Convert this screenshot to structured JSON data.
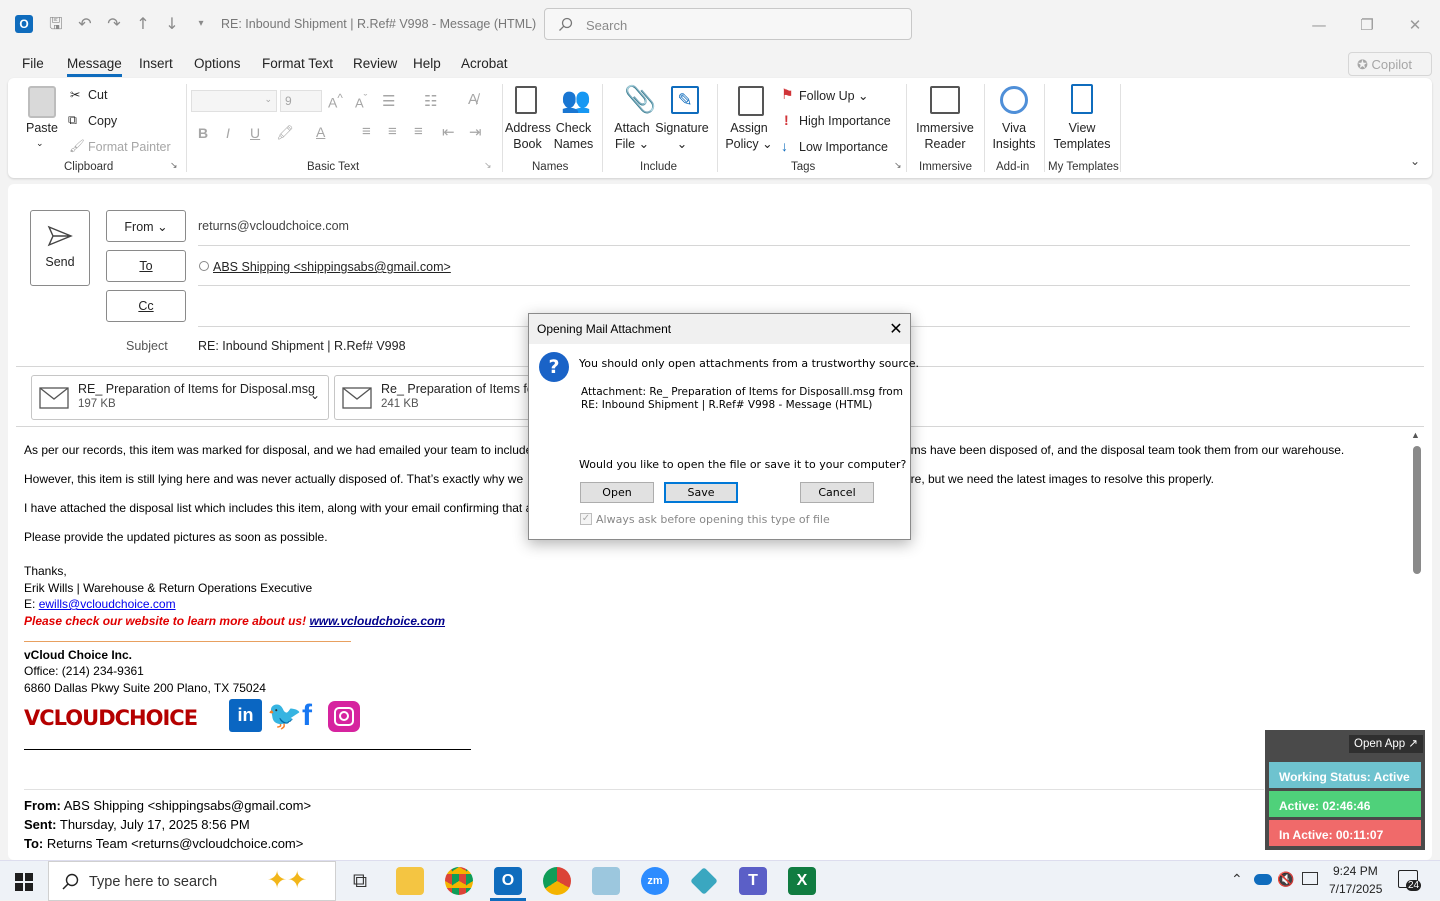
{
  "titlebar": {
    "title": "RE: Inbound Shipment | R.Ref# V998  -  Message (HTML)",
    "search_placeholder": "Search",
    "copilot": "Copilot"
  },
  "menu": [
    "File",
    "Message",
    "Insert",
    "Options",
    "Format Text",
    "Review",
    "Help",
    "Acrobat"
  ],
  "ribbon": {
    "clipboard": {
      "paste": "Paste",
      "cut": "Cut",
      "copy": "Copy",
      "format_painter": "Format Painter",
      "label": "Clipboard"
    },
    "basic_text": {
      "font_size": "9",
      "label": "Basic Text"
    },
    "names": {
      "address_book": [
        "Address",
        "Book"
      ],
      "check_names": [
        "Check",
        "Names"
      ],
      "label": "Names"
    },
    "include": {
      "attach_file": [
        "Attach",
        "File"
      ],
      "signature": "Signature",
      "label": "Include"
    },
    "tags": {
      "assign_policy": [
        "Assign",
        "Policy"
      ],
      "follow_up": "Follow Up",
      "high_importance": "High Importance",
      "low_importance": "Low Importance",
      "label": "Tags"
    },
    "immersive": {
      "reader": [
        "Immersive",
        "Reader"
      ],
      "label": "Immersive"
    },
    "addin": {
      "viva": [
        "Viva",
        "Insights"
      ],
      "label": "Add-in"
    },
    "templates": {
      "view": [
        "View",
        "Templates"
      ],
      "label": "My Templates"
    }
  },
  "compose": {
    "send": "Send",
    "from_label": "From",
    "from_value": "returns@vcloudchoice.com",
    "to_label": "To",
    "to_value": "ABS Shipping <shippingsabs@gmail.com>",
    "cc_label": "Cc",
    "subject_label": "Subject",
    "subject_value": "RE: Inbound Shipment | R.Ref# V998",
    "attachments": [
      {
        "name": "RE_ Preparation of Items for Disposal.msg",
        "size": "197 KB"
      },
      {
        "name": "Re_ Preparation of Items for",
        "size": "241 KB"
      }
    ]
  },
  "body": {
    "p1a": "As per our records, this item was marked for disposal, and we had emailed your team to include",
    "p1b": "ems have been disposed of, and the disposal team took them from our warehouse.",
    "p2a": "However, this item is still lying here and was never actually disposed of. That’s exactly why we",
    "p2b": "ore, but we need the latest images to resolve this properly.",
    "p3a": "I have attached the disposal list which includes this item, along with your email confirming that a",
    "p4": "Please provide the updated pictures as soon as possible.",
    "thanks": "Thanks,",
    "sig_name": "Erik Wills | Warehouse & Return Operations Executive",
    "sig_email_label": "E:",
    "sig_email": "ewills@vcloudchoice.com",
    "sig_promo": "Please check our website to learn more about us!",
    "sig_site": "www.vcloudchoice.com",
    "company": "vCloud Choice Inc.",
    "office": "Office: (214) 234-9361",
    "address": "6860 Dallas Pkwy Suite 200 Plano, TX 75024",
    "logo_text": "VCLOUDCHOICE",
    "fwd_from_label": "From:",
    "fwd_from": "ABS Shipping <shippingsabs@gmail.com>",
    "fwd_sent_label": "Sent:",
    "fwd_sent": "Thursday, July 17, 2025 8:56 PM",
    "fwd_to_label": "To:",
    "fwd_to": "Returns Team <returns@vcloudchoice.com>"
  },
  "dialog": {
    "title": "Opening Mail Attachment",
    "warning": "You should only open attachments from a trustworthy source.",
    "attachment_line1": "Attachment: Re_ Preparation of Items for Disposalll.msg from",
    "attachment_line2": "RE: Inbound Shipment | R.Ref# V998 - Message (HTML)",
    "question": "Would you like to open the file or save it to your computer?",
    "open": "Open",
    "save": "Save",
    "cancel": "Cancel",
    "always_ask": "Always ask before opening this type of file"
  },
  "widget": {
    "open_app": "Open App ↗",
    "status": "Working Status: Active",
    "active": "Active: 02:46:46",
    "inactive": "In Active: 00:11:07"
  },
  "taskbar": {
    "search_placeholder": "Type here to search",
    "time": "9:24 PM",
    "date": "7/17/2025",
    "notif_count": "24"
  }
}
